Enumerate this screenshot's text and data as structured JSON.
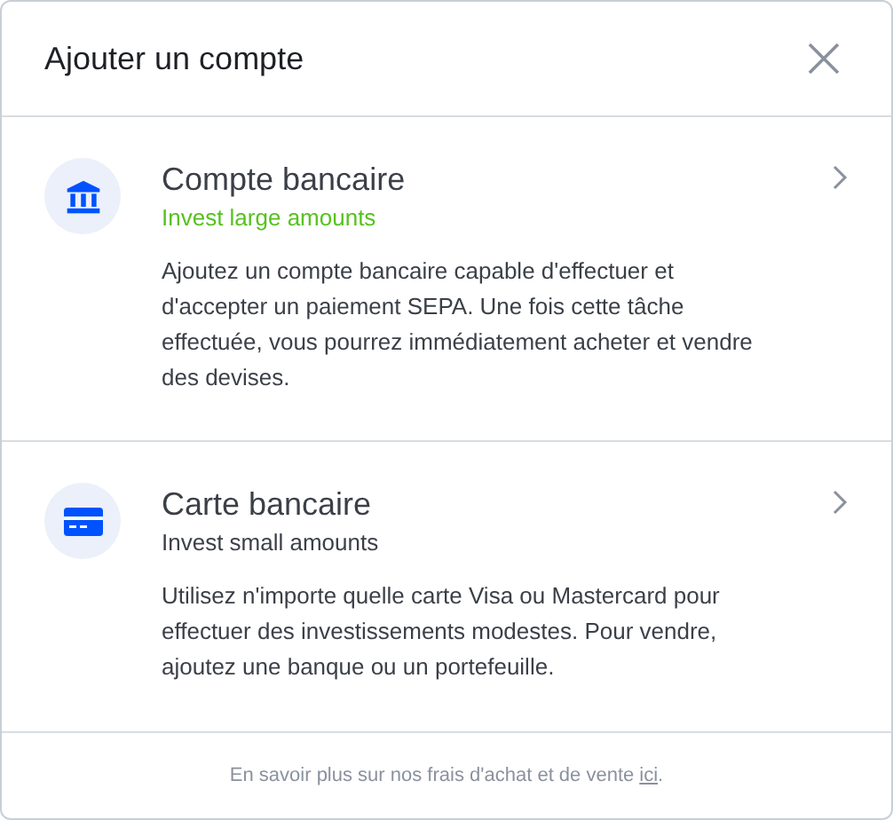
{
  "dialog": {
    "title": "Ajouter un compte"
  },
  "options": [
    {
      "kind": "bank",
      "title": "Compte bancaire",
      "subtitle": "Invest large amounts",
      "subtitle_highlighted": true,
      "description": "Ajoutez un compte bancaire capable d'effectuer et d'accepter un paiement SEPA. Une fois cette tâche effectuée, vous pourrez immédiatement acheter et vendre des devises."
    },
    {
      "kind": "card",
      "title": "Carte bancaire",
      "subtitle": "Invest small amounts",
      "subtitle_highlighted": false,
      "description": "Utilisez n'importe quelle carte Visa ou Mastercard pour effectuer des investissements modestes. Pour vendre, ajoutez une banque ou un portefeuille."
    }
  ],
  "footer": {
    "text": "En savoir plus sur nos frais d'achat et de vente",
    "link": "ici",
    "end": "."
  }
}
